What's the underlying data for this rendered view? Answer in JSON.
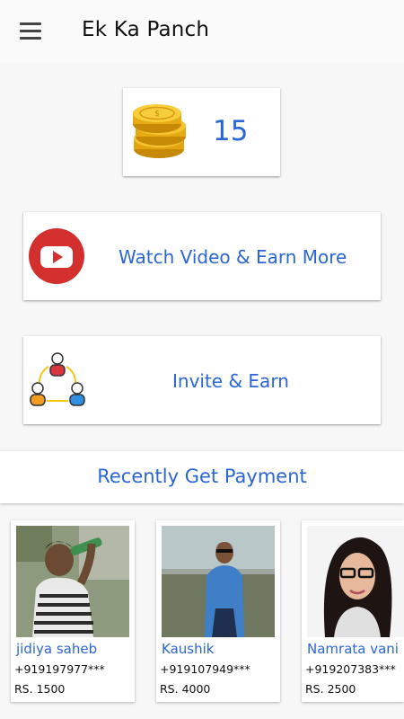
{
  "appbar": {
    "title": "Ek Ka Panch",
    "menu_icon": "hamburger-menu-icon"
  },
  "coins": {
    "count": "15",
    "icon": "gold-coins-icon"
  },
  "watch_video": {
    "label": "Watch Video & Earn More",
    "icon": "youtube-play-icon"
  },
  "invite": {
    "label": "Invite & Earn",
    "icon": "referral-users-icon"
  },
  "recent_section": {
    "title": "Recently Get Payment"
  },
  "payments": [
    {
      "name": "jidiya saheb",
      "phone": "+919197977***",
      "amount": "RS. 1500"
    },
    {
      "name": "Kaushik",
      "phone": "+919107949***",
      "amount": "RS. 4000"
    },
    {
      "name": "Namrata vani",
      "phone": "+919207383***",
      "amount": "RS. 2500"
    }
  ],
  "colors": {
    "accent": "#2b66d6",
    "background": "#f7f7f7",
    "card": "#ffffff"
  }
}
